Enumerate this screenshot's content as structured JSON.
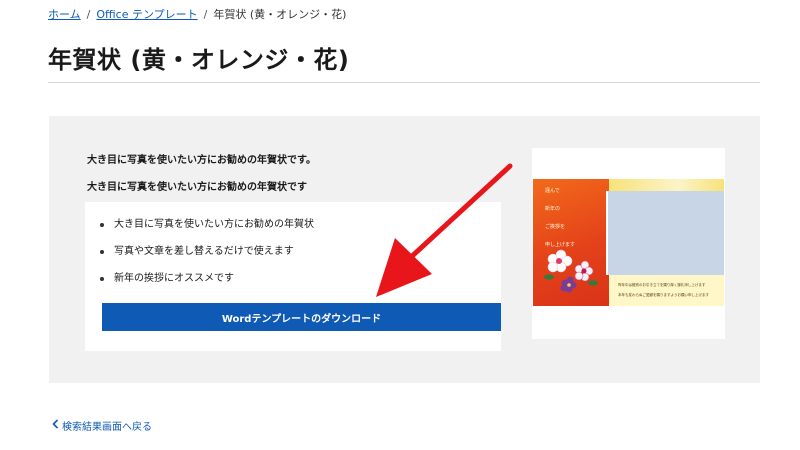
{
  "breadcrumb": {
    "home": "ホーム",
    "category": "Office テンプレート",
    "current": "年賀状 (黄・オレンジ・花)",
    "separator": "/"
  },
  "page_title": "年賀状 (黄・オレンジ・花)",
  "description": {
    "line1": "大き目に写真を使いたい方にお勧めの年賀状です。",
    "line2": "大き目に写真を使いたい方にお勧めの年賀状です"
  },
  "features": [
    "大き目に写真を使いたい方にお勧めの年賀状",
    "写真や文章を差し替えるだけで使えます",
    "新年の挨拶にオススメです"
  ],
  "download_button": "Wordテンプレートのダウンロード",
  "preview": {
    "greeting": [
      "謹んで",
      "新年の",
      "ご挨拶を",
      "申し上げます"
    ],
    "footer_line1": "昨年中は格別のお引き立てを賜り厚く御礼申し上げます",
    "footer_line2": "本年も変わらぬご愛顧を賜りますようお願い申し上げます"
  },
  "back_link": "検索結果画面へ戻る",
  "colors": {
    "accent": "#0f5ab5",
    "arrow": "#e8161b",
    "panel_bg": "#f1f1f1"
  },
  "icons": {
    "back": "chevron-left-icon",
    "annotation": "red-arrow-icon"
  }
}
